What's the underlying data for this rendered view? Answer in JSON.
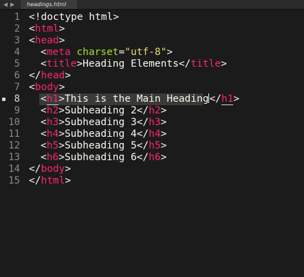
{
  "tabbar": {
    "nav_icons": [
      "left-arrow",
      "right-arrow"
    ],
    "active_tab": "headings.html"
  },
  "editor": {
    "current_line": 8,
    "lines": [
      {
        "num": "1",
        "doctype": "<!doctype html>"
      },
      {
        "num": "2",
        "open": "<",
        "tag": "html",
        "close": ">"
      },
      {
        "num": "3",
        "open": "<",
        "tag": "head",
        "close": ">"
      },
      {
        "num": "4",
        "open": "<",
        "tag": "meta",
        "space": " ",
        "attr": "charset",
        "eq": "=",
        "str": "\"utf-8\"",
        "close": ">"
      },
      {
        "num": "5",
        "open": "<",
        "tag": "title",
        "close": ">",
        "text": "Heading Elements",
        "open2": "</",
        "tag2": "title",
        "close2": ">"
      },
      {
        "num": "6",
        "open": "</",
        "tag": "head",
        "close": ">"
      },
      {
        "num": "7",
        "open": "<",
        "tag": "body",
        "close": ">"
      },
      {
        "num": "8",
        "open": "<",
        "tag": "h1",
        "close": ">",
        "text": "This is the Main Heading",
        "open2": "</",
        "tag2": "h1",
        "close2": ">"
      },
      {
        "num": "9",
        "open": "<",
        "tag": "h2",
        "close": ">",
        "text": "Subheading 2",
        "open2": "</",
        "tag2": "h2",
        "close2": ">"
      },
      {
        "num": "10",
        "open": "<",
        "tag": "h3",
        "close": ">",
        "text": "Subheading 3",
        "open2": "</",
        "tag2": "h3",
        "close2": ">"
      },
      {
        "num": "11",
        "open": "<",
        "tag": "h4",
        "close": ">",
        "text": "Subheading 4",
        "open2": "</",
        "tag2": "h4",
        "close2": ">"
      },
      {
        "num": "12",
        "open": "<",
        "tag": "h5",
        "close": ">",
        "text": "Subheading 5",
        "open2": "</",
        "tag2": "h5",
        "close2": ">"
      },
      {
        "num": "13",
        "open": "<",
        "tag": "h6",
        "close": ">",
        "text": "Subheading 6",
        "open2": "</",
        "tag2": "h6",
        "close2": ">"
      },
      {
        "num": "14",
        "open": "</",
        "tag": "body",
        "close": ">"
      },
      {
        "num": "15",
        "open": "</",
        "tag": "html",
        "close": ">"
      }
    ]
  }
}
